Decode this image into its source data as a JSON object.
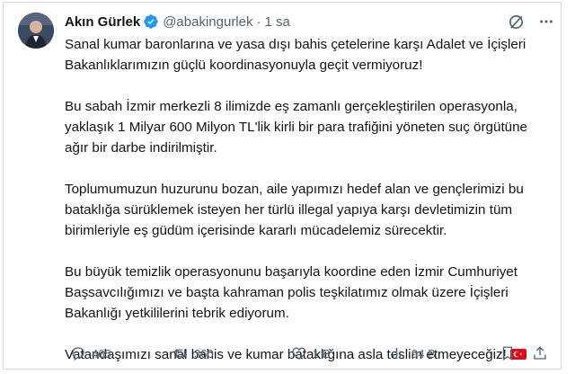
{
  "author": {
    "name": "Akın Gürlek",
    "handle": "@abakingurlek",
    "separator": "·",
    "time": "1 sa"
  },
  "icons": {
    "verified": "verified-badge-icon",
    "grok": "grok-icon",
    "more": "more-options-icon"
  },
  "body": {
    "p1": "Sanal kumar baronlarına ve yasa dışı bahis çetelerine karşı Adalet ve İçişleri Bakanlıklarımızın güçlü koordinasyonuyla geçit vermiyoruz!",
    "p2": "Bu sabah İzmir merkezli 8 ilimizde eş zamanlı gerçekleştirilen operasyonla, yaklaşık 1 Milyar 600 Milyon TL'lik kirli bir para trafiğini yöneten suç örgütüne ağır bir darbe indirilmiştir.",
    "p3": "Toplumumuzun huzurunu bozan, aile yapımızı hedef alan ve gençlerimizi bu bataklığa sürüklemek isteyen her türlü illegal yapıya karşı devletimizin tüm birimleriyle eş güdüm içerisinde kararlı mücadelemiz sürecektir.",
    "p4": "Bu büyük temizlik operasyonunu başarıyla koordine eden İzmir Cumhuriyet Başsavcılığımızı ve başta kahraman polis teşkilatımız olmak üzere İçişleri Bakanlığı yetkililerini tebrik ediyorum.",
    "p5": "Vatandaşımızı sanal bahis ve kumar bataklığına asla teslim etmeyeceğiz!"
  },
  "metrics": {
    "replies": "465",
    "reposts": "360",
    "likes": "1 B",
    "views": "94 B"
  },
  "colors": {
    "text": "#0f1419",
    "muted": "#536471",
    "verified": "#1d9bf0",
    "flag": "#e30a17"
  }
}
